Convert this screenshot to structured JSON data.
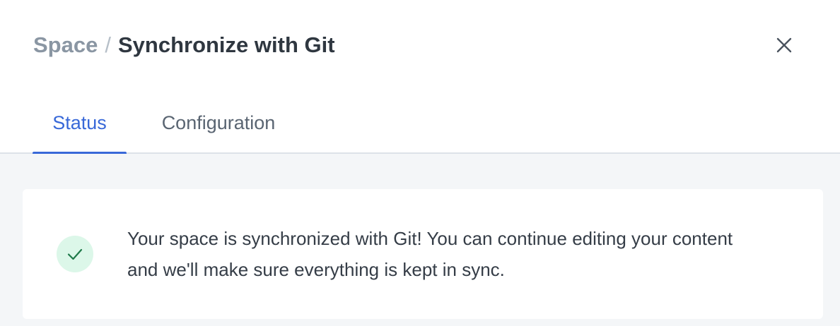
{
  "header": {
    "breadcrumb_parent": "Space",
    "breadcrumb_separator": "/",
    "title": "Synchronize with Git",
    "close_icon": "close-icon"
  },
  "tabs": [
    {
      "label": "Status",
      "active": true
    },
    {
      "label": "Configuration",
      "active": false
    }
  ],
  "status": {
    "icon": "check-icon",
    "message": "Your space is synchronized with Git! You can continue editing your content and we'll make sure everything is kept in sync."
  },
  "colors": {
    "accent": "#3868d8",
    "success_bg": "#dcf7e9",
    "success_check": "#1f7a4a",
    "panel_bg": "#f4f6f8"
  }
}
